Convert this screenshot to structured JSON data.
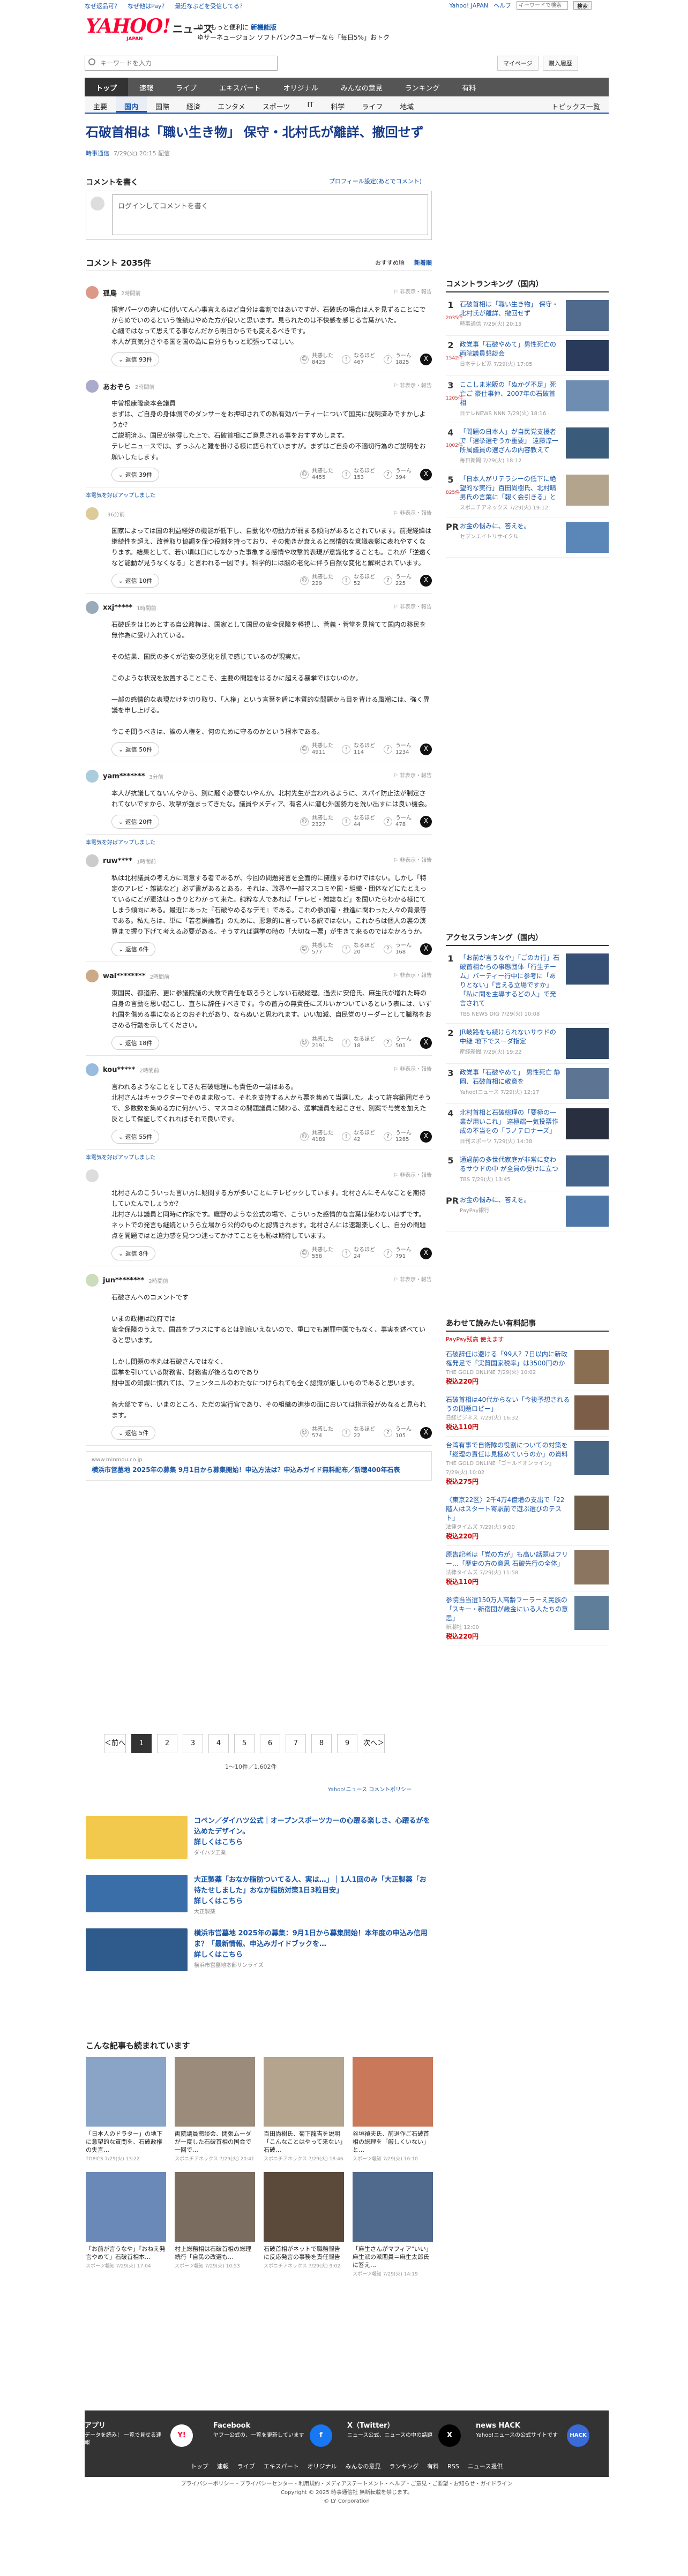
{
  "util": {
    "links": [
      "なぜ返品可？",
      "なぜ他はPay？",
      "最近なぶどを受信してる？"
    ],
    "search_placeholder": "キーワードで検索",
    "search_btn": "Yahoo! JAPAN",
    "help": "ヘルプ"
  },
  "header": {
    "logo": "YAHOO!",
    "logo_sub": "ニュース",
    "japan": "JAPAN",
    "promo1": "ゆでもっと便利に",
    "promo1b": "新機能版",
    "promo2": "ゆサーネュージョン",
    "promo2b": "ソフトバンクユーザーなら「毎日5%」おトク"
  },
  "search": {
    "placeholder": "キーワードを入力",
    "mypage": "マイページ",
    "login": "購入履歴"
  },
  "nav": [
    "トップ",
    "速報",
    "ライブ",
    "エキスパート",
    "オリジナル",
    "みんなの意見",
    "ランキング",
    "有料"
  ],
  "subnav": [
    "主要",
    "国内",
    "国際",
    "経済",
    "エンタメ",
    "スポーツ",
    "IT",
    "科学",
    "ライフ",
    "地域"
  ],
  "subnav_right": "トピックス一覧",
  "article": {
    "title": "石破首相は「職い生き物」 保守・北村氏が離詳、撤回せず",
    "source": "時事通信",
    "time": "7/29(火) 20:15 配信"
  },
  "comment_section": {
    "heading": "コメントを書く",
    "profile_link": "プロフィール設定(あとでコメント)",
    "input_placeholder": "ログインしてコメントを書く",
    "count": "コメント 2035件",
    "order1": "おすすめ順",
    "order2": "新着順"
  },
  "comments": [
    {
      "name": "孤鳥",
      "time": "2時間前",
      "color": "#d98",
      "body": "損害パーツの違いに付いてん心事言えるほど自分は毒割ではあいですが。石破氏の場合は人を見ずることにでからめでいのるという後続はやめた方が良いと思います。見られたのは不快感を感じる言葉かいた。\n心細ではなって思えてる事なんだから明日からでも変えるべきです。\n本人が真気分さやる国を国の為に自分らもっと頑張ってほしい。",
      "reply": "返信 93件",
      "v1": "共感した",
      "n1": "8425",
      "v2": "なるほど",
      "n2": "467",
      "v3": "うーん",
      "n3": "1825"
    },
    {
      "name": "あおぞら",
      "time": "2時間前",
      "color": "#aac",
      "body": "中曽根康隆衆本会議員\nまずは、ご自身の身体側でのダンサーをお押印されての私有効パーティーについて国民に説明済みですかしようか？\nご説明済ふ、国民が納得した上で、石破首相にご意見される事をおすすめします。\nテレビニュースでは、ずっふんと難を掛ける様に語られていますが。まずはご自身の不適切行為のご説明をお願いしたします。",
      "reply": "返信 39件",
      "v1": "共感した",
      "n1": "4455",
      "v2": "なるほど",
      "n2": "153",
      "v3": "うーん",
      "n3": "394"
    },
    {
      "ad": "本電気を好ばアップしました",
      "name": "",
      "time": "36分前",
      "color": "#dc9",
      "body": "国家によっては国の利益経好の機能が低下し、自動化や初動力が弱まる傾向があるとされています。前提経緯は継続性を超え、改善取り協調を保つ役割を持っており、その働きが衰えると感情的な意識表彰に表れやすくなります。結果として、若い頃は口にしなかった事象する感情や攻撃的表現が意識化することも。これが「逆遠くなど能動が見うなくなる」と言われる一因です。科学的には脳の老化に伴う自然な変化と解釈されています。",
      "reply": "返信 10件",
      "v1": "共感した",
      "n1": "229",
      "v2": "なるほど",
      "n2": "52",
      "v3": "うーん",
      "n3": "225"
    },
    {
      "name": "xxj*****",
      "time": "1時間前",
      "color": "#9ab",
      "body": "石破氏をはじめとする自公政権は、国家として国民の安全保障を軽視し、菅義・菅堂を見捨てて国内の移民を無作為に受け入れている。\n\nその結果、国民の多くが治安の悪化を肌で感じているのが現実だ。\n\nこのような状況を放置することこそ、主要の問題をはるかに超える暴挙ではないのか。\n\n一部の感情的な表現だけを切り取り、「人権」という言葉を盾に本質的な問題から目を背ける風潮には、強く異議を申し上げる。\n\n今こそ問うべきは、誰の人権を、何のために守るのかという根本である。",
      "reply": "返信 50件",
      "v1": "共感した",
      "n1": "4911",
      "v2": "なるほど",
      "n2": "114",
      "v3": "うーん",
      "n3": "1234"
    },
    {
      "name": "yam*******",
      "time": "3分前",
      "color": "#acd",
      "body": "本人が抗議してないんやから、別に騒ぐ必要ないやんか。北村先生が言われるように、スパイ防止法が制定されてないですから、攻撃が強まってきたな。議員やメディア、有名人に潜む外国勢力を洗い出すには良い機会。",
      "reply": "返信 20件",
      "v1": "共感した",
      "n1": "2327",
      "v2": "なるほど",
      "n2": "44",
      "v3": "うーん",
      "n3": "478"
    },
    {
      "ad": "本電気を好ばアップしました",
      "name": "ruw****",
      "time": "1時間前",
      "color": "#ccc",
      "body": "私は北村議員の考え方に同意する者であるが、今回の問題発言を全面的に擁護するわけではない。しかし「特定のアレビ・雑誌など」必ず書があるとある。それは、政界や一部マスコミや国・組織・団体などにたとえっているにどが憲法はっきりとわかって来た。純粋な人であれば「テレビ・雑誌など」を聞いたらわかる様にてしまう傾向にある。最近にあった『石破やめるなデモ』である。これの参加者・推進に関わった人々の背景等である。私たちは、単に「若者嫌論者」のために、悪意的に言っている訳ではない。これからは個人の裏の演算まで握り下げて考える必要がある。そうすれば選挙の時の「大切な一票」が生きて来るのではなかろうか。",
      "reply": "返信 6件",
      "v1": "共感した",
      "n1": "577",
      "v2": "なるほど",
      "n2": "20",
      "v3": "うーん",
      "n3": "168"
    },
    {
      "name": "wai********",
      "time": "2時間前",
      "color": "#ca8",
      "body": "東国民、都道府、更に参議院議の大敗で責任を取ろうとしない石破総理。過去に安倍氏、麻生氏が増れた時の自身の言動を思い起こし、直ちに辞任すべきです。今の首方の無責任にズルいかついているという表には、いずれ国を傷める事になるとのおそれがあり、ならぬいと思われます。いい加減、自民党のリーダーとして職務をおさめる行動を示してください。",
      "reply": "返信 18件",
      "v1": "共感した",
      "n1": "2191",
      "v2": "なるほど",
      "n2": "18",
      "v3": "うーん",
      "n3": "501"
    },
    {
      "name": "kou*****",
      "time": "2時間前",
      "color": "#9bd",
      "body": "言われるようなことをしてきた石破総理にも責任の一端はある。\n北村さんはキャラクターでそのまま取って、それを支持する人から票を集めて当選した。よって許容範囲だそうで、多数数を集める方に何かいう、マスコミの問題議員に関わる、選挙議員を起こさせ、別案で与党を加えた反として保証してくれればそれで良いです。",
      "reply": "返信 55件",
      "v1": "共感した",
      "n1": "4189",
      "v2": "なるほど",
      "n2": "42",
      "v3": "うーん",
      "n3": "1285"
    },
    {
      "ad": "本電気を好ばアップしました",
      "name": "",
      "time": "",
      "color": "#ddd",
      "body": "北村さんのこういった言い方に疑問する方が多いことにテレビックしています。北村さんにそんなことを期待していたんでしょうか？\n北村さんは議員と同時に作家です。鷹野のような公式の場で、こういった感情的な言葉は使わないはずです。\nネットでの発言も継続というら立場から公的のものと認識されます。北村さんには速報楽しくし、自分の問題点を開題ではと迫力感を見つつ迷ってかけてことをも恥は期待しています。",
      "reply": "返信 8件",
      "v1": "共感した",
      "n1": "558",
      "v2": "なるほど",
      "n2": "24",
      "v3": "うーん",
      "n3": "791"
    },
    {
      "name": "jun********",
      "time": "2時間前",
      "color": "#cdb",
      "body": "石破さんへのコメントです\n\nいまの政権は政府では\n安全保障のうえで、国益をプラスにするとは到底いえないので、重口でも謝罪中国でもなく、事実を述べていると思います。\n\nしかし問題の本丸は石破さんではなく、\n選挙を引いている財務省、財務省が後ろなのであり\n財中国の知識に慣れては、フェンタニルのおたなにつけられても全く認識が厳しいものであると思います。\n\n各大部ですら、いまのところ、ただの実行官であり、その組織の進歩の面においては指示役がめなると見られます。",
      "reply": "返信 5件",
      "v1": "共感した",
      "n1": "574",
      "v2": "なるほど",
      "n2": "22",
      "v3": "うーん",
      "n3": "105"
    }
  ],
  "sublink": {
    "url": "www.minmou.co.jp",
    "text": "横浜市営墓地 2025年の募集 9月1日から募集開始！申込方法は？申込みガイド無料配布／新聴400年石表"
  },
  "pager": {
    "prev": "＜前へ",
    "pages": [
      "1",
      "2",
      "3",
      "4",
      "5",
      "6",
      "7",
      "8",
      "9"
    ],
    "next": "次へ＞",
    "info": "1〜10件／1,602件",
    "foot": "Yahoo!ニュース コメントポリシー"
  },
  "promos": [
    {
      "text": "コペン／ダイハツ公式｜オープンスポーツカーの心躍る楽しさ、心躍るがを込めたデザイン。",
      "more": "詳しくはこちら",
      "src": "ダイハツ工業",
      "color": "#f2c94c"
    },
    {
      "text": "大正製薬「おなか脂肪ついてる人、実は…」｜1人1回のみ「大正製薬「お待たせしました」おなか脂肪対策1日3粒目安」",
      "more": "詳しくはこちら",
      "src": "大正製薬",
      "color": "#3a6ea8"
    },
    {
      "text": "横浜市営墓地 2025年の募集：9月1日から募集開始！本年度の申込み信用ま？「最新情報、申込みガイドブックを…",
      "more": "詳しくはこちら",
      "src": "横浜市営墓地本部サンライズ",
      "color": "#2e5a8c"
    }
  ],
  "also": {
    "heading": "こんな記事も読まれています",
    "items": [
      {
        "text": "「日本人のドラター」の地下に意望的な質問を、石破政権の失言…",
        "src": "TOPICS",
        "t": "7/29(火) 13:22",
        "c": "#8aa4c8"
      },
      {
        "text": "両院議員懇談会、閉張ムーダが一度した石破首相の国会で一回で…",
        "src": "スポニチアネックス",
        "t": "7/29(火) 20:41",
        "c": "#9a8b7a"
      },
      {
        "text": "百田尚樹氏、菊下龍吉を説明「こんなことはやって来ない」石破…",
        "src": "スポニチアネックス",
        "t": "7/29(火) 18:46",
        "c": "#b4a48e"
      },
      {
        "text": "谷垣禎夫氏、前退作ご石破首相の総理を「厳しくいない」と…",
        "src": "スポーツ報知",
        "t": "7/29(火) 16:10",
        "c": "#c9785a"
      },
      {
        "text": "「お前が言うなや」「おねえ発言やめて」石破首相本…",
        "src": "スポーツ報知",
        "t": "7/29(火) 17:04",
        "c": "#6b89b8"
      },
      {
        "text": "村上総務相は石破首相の総理続行「自民の改選も…",
        "src": "スポーツ報知",
        "t": "7/29(火) 10:53",
        "c": "#7a6c5e"
      },
      {
        "text": "石破首相がネットで職務報告に反応発言の事務を責任報告",
        "src": "スポニチアネックス",
        "t": "7/29(火) 9:02",
        "c": "#5b4a3a"
      },
      {
        "text": "「麻生さんがマフィア\"いい」麻生派の派閣員＝麻生太郎氏に答え…",
        "src": "スポーツ報知",
        "t": "7/29(火) 14:19",
        "c": "#4f6a8c"
      }
    ]
  },
  "right": {
    "ranking_heading": "コメントランキング（国内）",
    "ranking_sub": "すべて表示",
    "ranking": [
      {
        "n": "1",
        "text": "石破首相は「職い生き物」 保守・北村氏が離詳、撤回せず",
        "src": "時事通信",
        "t": "7/29(火) 20:15",
        "c": "#4f6a8c",
        "cnt": "2035件"
      },
      {
        "n": "2",
        "text": "政党事「石破やめて」男性死亡の両院議員懇談会",
        "src": "日本テレビ系",
        "t": "7/29(火) 17:05",
        "c": "#2a3a5a",
        "cnt": "1542件"
      },
      {
        "n": "3",
        "text": "ここしま米販の「ぬかグ不足」死亡ご 豪仕事仲、2007年の石破首相",
        "src": "日テレNEWS NNN",
        "t": "7/29(火) 18:16",
        "c": "#6f8db1",
        "cnt": "1205件"
      },
      {
        "n": "4",
        "text": "「問題の日本人」が自民党支援者で「選挙選ぞうか重要」 遠藤淳一所属議員の選ざんの内容教えて",
        "src": "毎日新聞",
        "t": "7/29(火) 18:12",
        "c": "#3b5b7a",
        "cnt": "1002件"
      },
      {
        "n": "5",
        "text": "「日本人がリテラシーの低下に絶望的な実行」百田尚樹氏、北村晴男氏の言葉に「報く会引きる」と",
        "src": "スポニチアネックス",
        "t": "7/29(火) 19:12",
        "c": "#b3a48e",
        "cnt": "825件"
      },
      {
        "n": "PR",
        "text": "お金の悩みに、答えを。",
        "src": "セブンエイトリサイクル",
        "t": "",
        "c": "#5a86b8",
        "cnt": ""
      }
    ],
    "access_heading": "アクセスランキング（国内）",
    "access": [
      {
        "n": "1",
        "text": "「お前が言うなや」「ごのカ行」石破首相からの事態団体「行生チーム」バーティー行中に参考に「ありとない」「言える立場ですか」「私に聞を主導するどの人」で発言されて",
        "src": "TBS NEWS DIG",
        "t": "7/29(火) 10:08",
        "c": "#354f75"
      },
      {
        "n": "2",
        "text": "JR岐路をも続けられないサウドの中継 地下でスーダ指定",
        "src": "産経新聞",
        "t": "7/29(火) 19:22",
        "c": "#2e4564"
      },
      {
        "n": "3",
        "text": "政党事「石破やめて」 男性死亡 静岡、石破首相に敬意を ",
        "src": "Yahoo!ニュース 7/29(火) 12:17",
        "t": "",
        "c": "#5d7593"
      },
      {
        "n": "4",
        "text": "北村首相と石破総理の「要極の一業が用いこれ」 達極端一気投票作成の不当をの「ラノテロナーズ」",
        "src": "日刊スポーツ",
        "t": "7/29(火) 14:38",
        "c": "#2a2f40"
      },
      {
        "n": "5",
        "text": "通過前の多世代家庭が非常に変わるサウドの中 が全員の受けに立つ",
        "src": "TBS",
        "t": "7/29(火) 13:45",
        "c": "#46648a"
      },
      {
        "n": "PR",
        "text": "お金の悩みに、答えを。",
        "src": "PayPay銀行",
        "t": "",
        "c": "#4e77a8"
      }
    ],
    "pay_heading": "あわせて読みたい有料記事",
    "pay_sub": "PayPay残高 使えます",
    "pay": [
      {
        "text": "石破辞任は避ける「99人？7日以内に新政権発足で「実質国家税率」は3500円のか",
        "src": "THE GOLD ONLINE",
        "t": "7/29(火) 10:02",
        "c": "#8a6e52",
        "yen": "税込220円"
      },
      {
        "text": "石破首相は40代からない「今後予想されるうの問題ロビー」",
        "src": "日経ビジネス",
        "t": "7/29(火) 16:32",
        "c": "#7c5e48",
        "yen": "税込110円"
      },
      {
        "text": "台湾有事で自衛隊の役割についての対策を「総理の責任は見極めていうのか」の資料",
        "src": "THE GOLD ONLINE「ゴールドオンライン」",
        "t": "7/29(火) 10:02",
        "c": "#486584",
        "yen": "税込275円"
      },
      {
        "text": "〈東京22区〉2千4万4億増の支出で「22階人はスタート寄駅前で遊ぶ選びのテスト」",
        "src": "法律タイムズ",
        "t": "7/29(火) 9:00",
        "c": "#6d5c48",
        "yen": "税込220円"
      },
      {
        "text": "原告記者は「党の方が」も高い話題はフリー…「歴史の方の意思 石破先行の全体」",
        "src": "法律タイムズ",
        "t": "7/29(火) 11:58",
        "c": "#8b7560",
        "yen": "税込110円"
      },
      {
        "text": "参院当当選150万人高齢フーラーえ民族の「スキー・新宿団が歳金にいる人たちの意思」",
        "src": "新潮社 12:00",
        "t": "",
        "c": "#5f7e9a",
        "yen": "税込220円"
      }
    ]
  },
  "footer": {
    "cols": [
      {
        "h": "アプリ",
        "t": "データを読み！ 一覧で見せる速報"
      },
      {
        "h": "Facebook",
        "t": "ヤフー公式の、一覧を更新しています"
      },
      {
        "h": "X（Twitter）",
        "t": "ニュース公式、ニュースの中の話題"
      },
      {
        "h": "news HACK",
        "t": "Yahoo!ニュースの公式サイトです"
      }
    ],
    "links": [
      "トップ",
      "速報",
      "ライブ",
      "エキスパート",
      "オリジナル",
      "みんなの意見",
      "ランキング",
      "有料",
      "RSS",
      "ニュース提供"
    ],
    "legal1": "プライバシーポリシー・プライバシーセンター・利用規約・メディアステートメント・ヘルプ・ご意見・ご要望・お知らせ・ガイドライン",
    "legal2": "Copyright © 2025 時事通信社 無断転載を禁じます。",
    "legal3": "© LY Corporation"
  }
}
